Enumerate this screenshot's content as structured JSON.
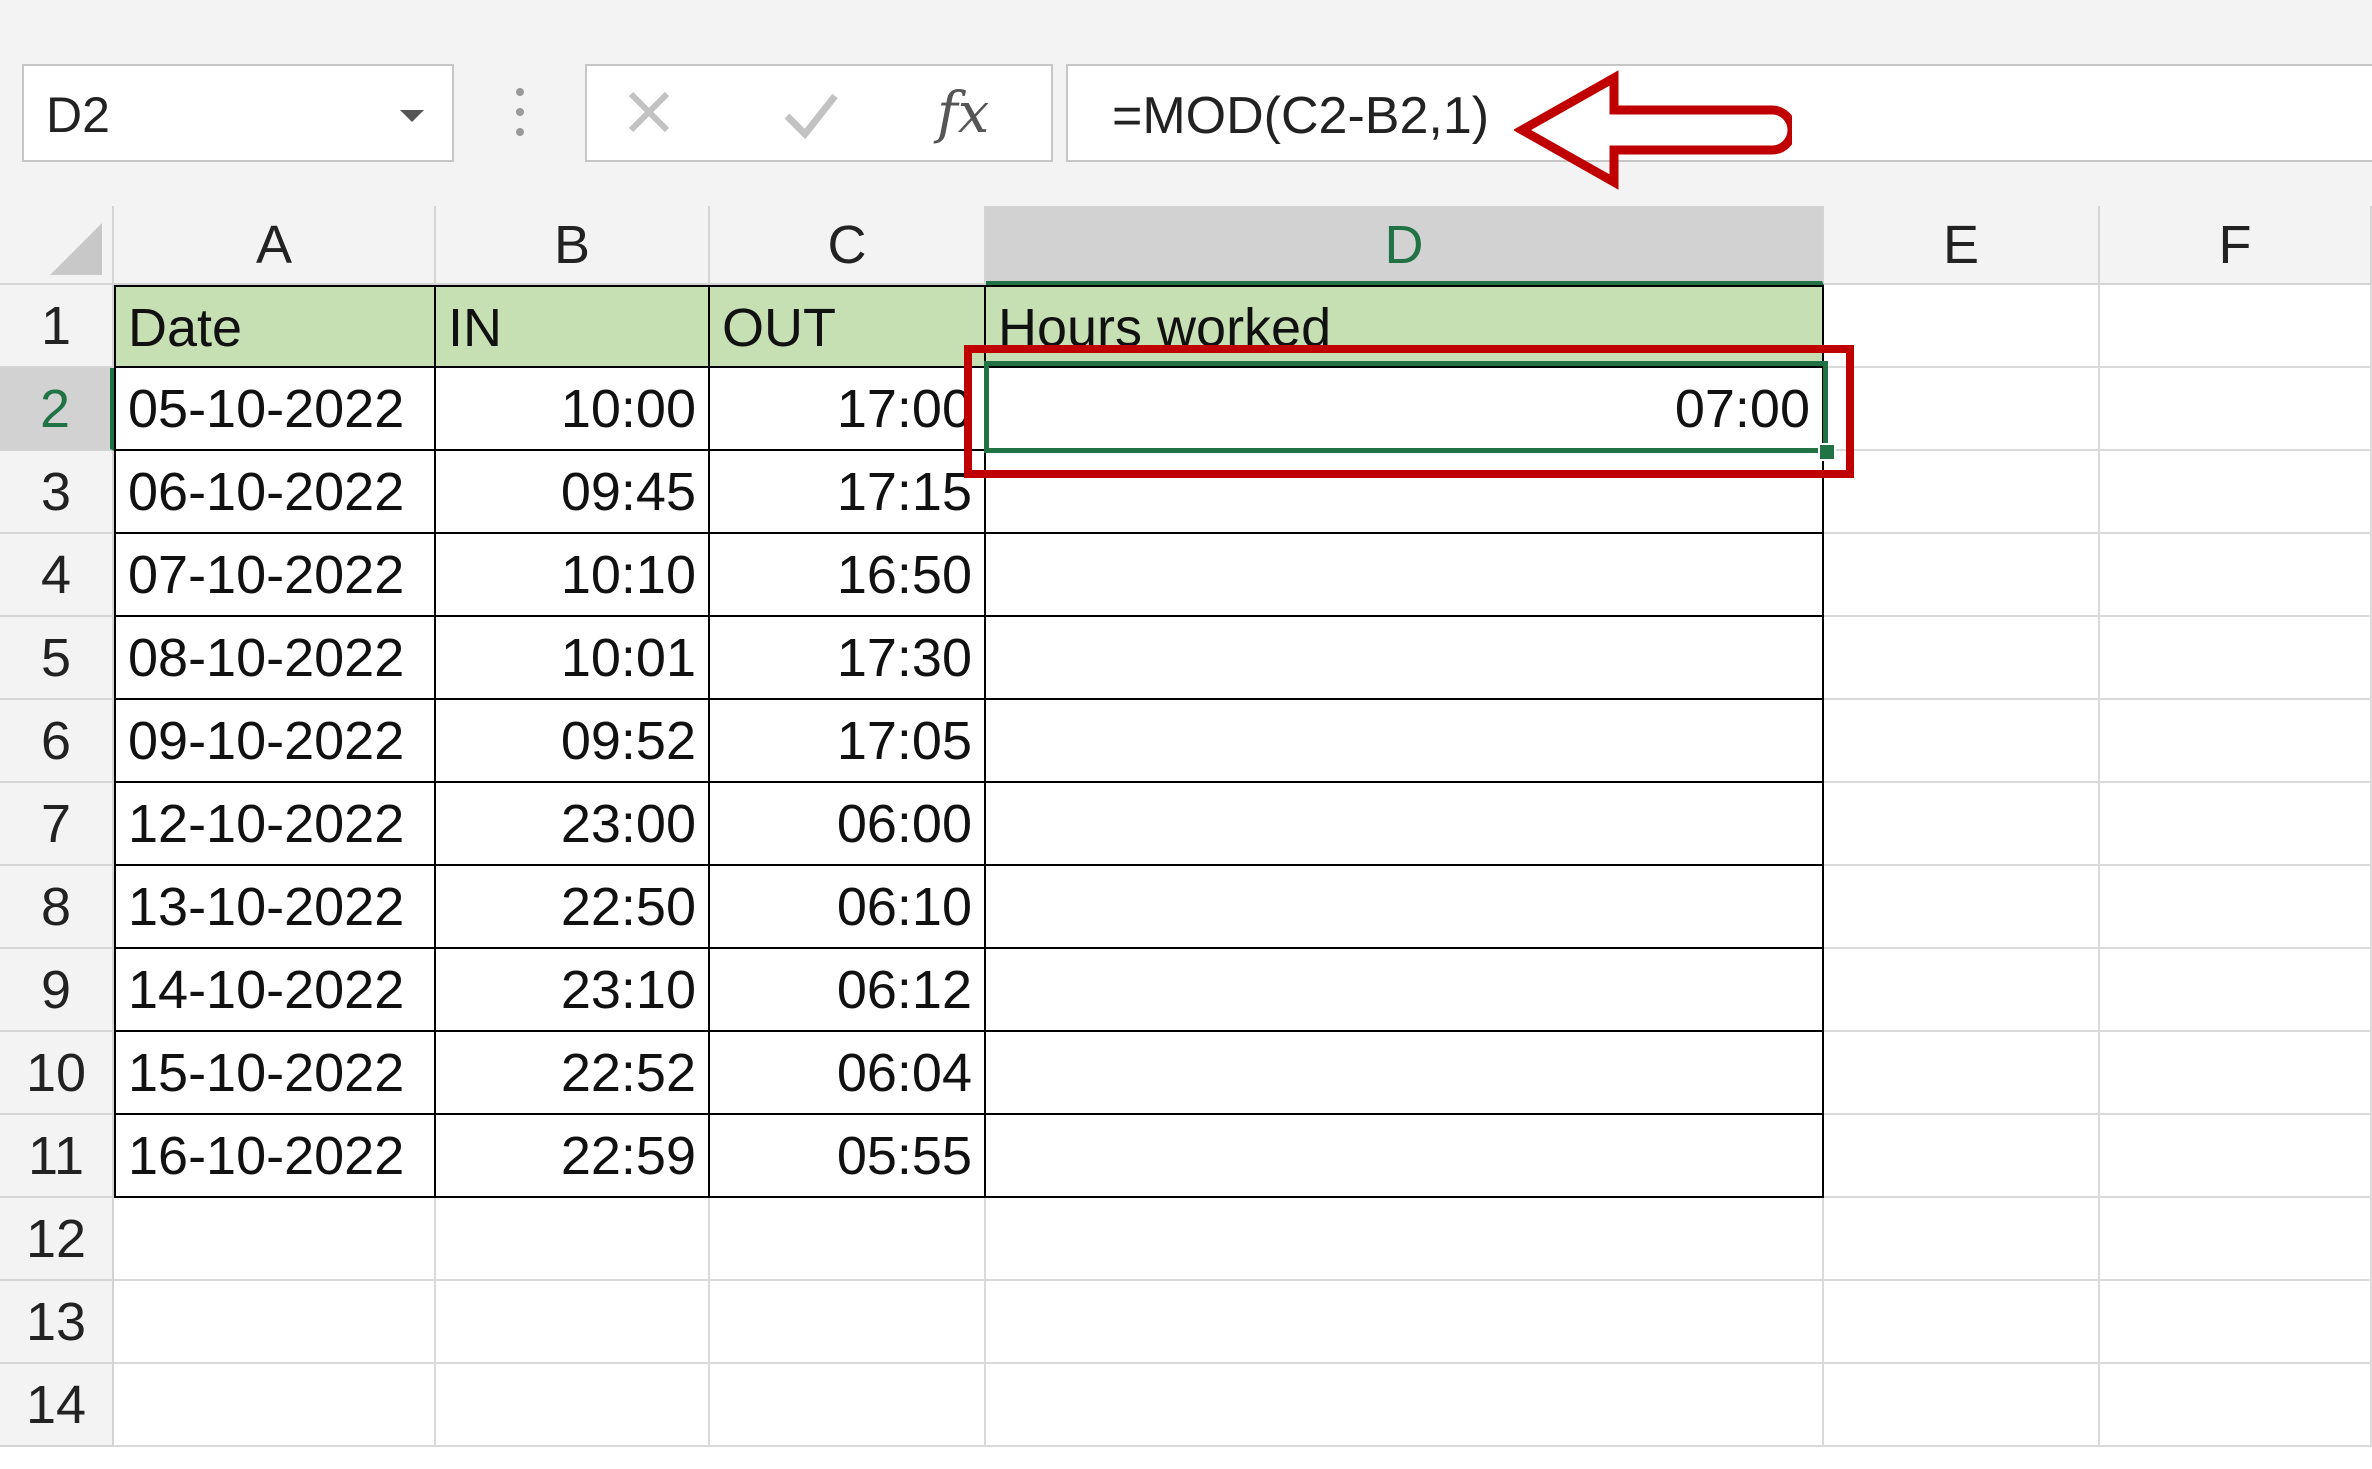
{
  "name_box": {
    "value": "D2"
  },
  "formula_bar": {
    "cancel_icon": "close-icon",
    "enter_icon": "check-icon",
    "function_label": "fx",
    "formula": "=MOD(C2-B2,1)"
  },
  "columns": [
    "A",
    "B",
    "C",
    "D",
    "E",
    "F"
  ],
  "rows": [
    "1",
    "2",
    "3",
    "4",
    "5",
    "6",
    "7",
    "8",
    "9",
    "10",
    "11",
    "12",
    "13",
    "14"
  ],
  "table": {
    "headers": {
      "date": "Date",
      "in": "IN",
      "out": "OUT",
      "hours": "Hours worked"
    },
    "rows": [
      {
        "date": "05-10-2022",
        "in": "10:00",
        "out": "17:00",
        "hours": "07:00"
      },
      {
        "date": "06-10-2022",
        "in": "09:45",
        "out": "17:15",
        "hours": ""
      },
      {
        "date": "07-10-2022",
        "in": "10:10",
        "out": "16:50",
        "hours": ""
      },
      {
        "date": "08-10-2022",
        "in": "10:01",
        "out": "17:30",
        "hours": ""
      },
      {
        "date": "09-10-2022",
        "in": "09:52",
        "out": "17:05",
        "hours": ""
      },
      {
        "date": "12-10-2022",
        "in": "23:00",
        "out": "06:00",
        "hours": ""
      },
      {
        "date": "13-10-2022",
        "in": "22:50",
        "out": "06:10",
        "hours": ""
      },
      {
        "date": "14-10-2022",
        "in": "23:10",
        "out": "06:12",
        "hours": ""
      },
      {
        "date": "15-10-2022",
        "in": "22:52",
        "out": "06:04",
        "hours": ""
      },
      {
        "date": "16-10-2022",
        "in": "22:59",
        "out": "05:55",
        "hours": ""
      }
    ]
  },
  "colors": {
    "header_fill": "#c6e0b4",
    "selection": "#217346",
    "annotation": "#c00000"
  }
}
